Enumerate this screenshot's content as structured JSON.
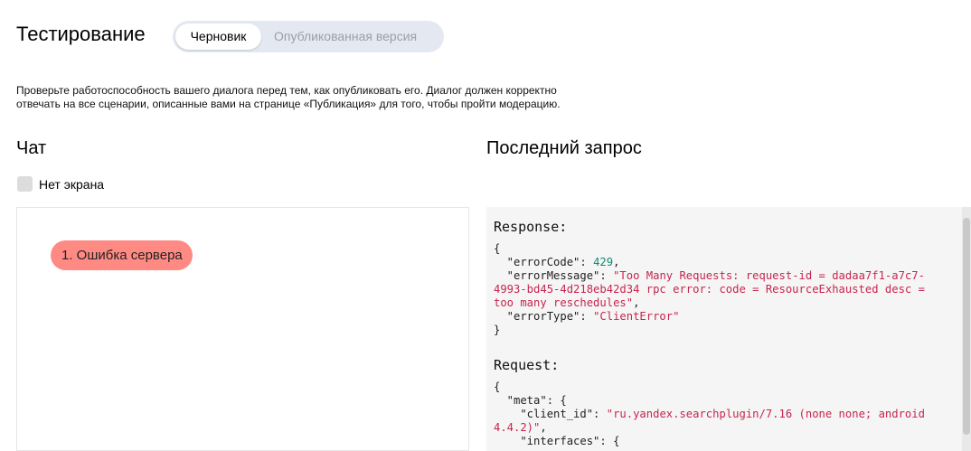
{
  "header": {
    "title": "Тестирование",
    "tabs": [
      {
        "label": "Черновик",
        "active": true
      },
      {
        "label": "Опубликованная версия",
        "active": false
      }
    ]
  },
  "description": {
    "line1": "Проверьте работоспособность вашего диалога перед тем, как опубликовать его. Диалог должен корректно",
    "line2": "отвечать на все сценарии, описанные вами на странице «Публикация» для того, чтобы пройти модерацию."
  },
  "chat": {
    "heading": "Чат",
    "no_screen_label": "Нет экрана",
    "messages": [
      "1. Ошибка сервера"
    ]
  },
  "last_request": {
    "heading": "Последний запрос",
    "response_label": "Response:",
    "request_label": "Request:",
    "response": {
      "open": "{",
      "errorCode_key": "  \"errorCode\": ",
      "errorCode_val": "429",
      "errorMessage_key": "  \"errorMessage\": ",
      "errorMessage_val1": "\"Too Many Requests: request-id = dadaa7f1-a7c7-",
      "errorMessage_val2": "4993-bd45-4d218eb42d34 rpc error: code = ResourceExhausted desc =",
      "errorMessage_val3": "too many reschedules\"",
      "errorType_key": "  \"errorType\": ",
      "errorType_val": "\"ClientError\"",
      "close": "}"
    },
    "request": {
      "open": "{",
      "meta": "  \"meta\": {",
      "client_id_key": "    \"client_id\": ",
      "client_id_val1": "\"ru.yandex.searchplugin/7.16 (none none; android",
      "client_id_val2": "4.4.2)\"",
      "interfaces": "    \"interfaces\": {"
    }
  },
  "colors": {
    "accent_bubble": "#ff8a84",
    "segment_bg": "#e4e9f1",
    "json_number": "#0b8c73",
    "json_string": "#c7254e"
  }
}
